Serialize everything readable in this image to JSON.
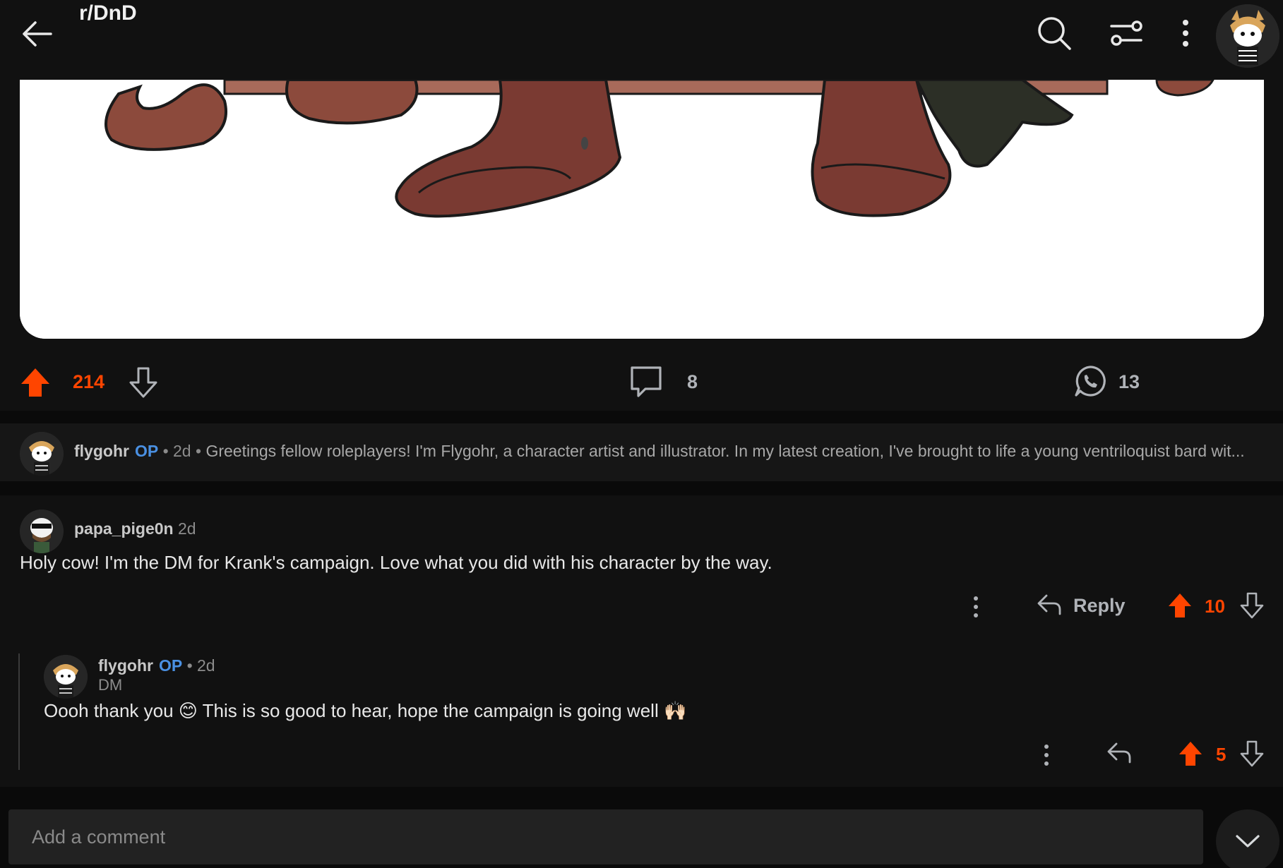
{
  "header": {
    "title": "r/DnD",
    "icons": [
      "back-arrow-icon",
      "search-icon",
      "filter-sliders-icon",
      "more-vertical-icon",
      "user-avatar"
    ]
  },
  "post": {
    "score": "214",
    "comment_count": "8",
    "share_count": "13"
  },
  "op_summary": {
    "username": "flygohr",
    "tag": "OP",
    "meta": " • 2d • ",
    "text": "Greetings fellow roleplayers! I'm Flygohr, a character artist and illustrator. In my latest creation, I've brought to life a young ventriloquist bard wit..."
  },
  "comments": [
    {
      "username": "papa_pige0n",
      "time": "2d",
      "body": "Holy cow! I'm the DM for Krank's campaign. Love what you did with his character by the way.",
      "reply_label": "Reply",
      "score": "10"
    },
    {
      "username": "flygohr",
      "tag": "OP",
      "time": " • 2d",
      "flair": "DM",
      "body": "Oooh thank you 😊 This is so good to hear, hope the campaign is going well 🙌🏻",
      "score": "5"
    }
  ],
  "composer": {
    "placeholder": "Add a comment"
  },
  "colors": {
    "accent": "#ff4500",
    "op_blue": "#4a90e2",
    "background": "#111111"
  }
}
